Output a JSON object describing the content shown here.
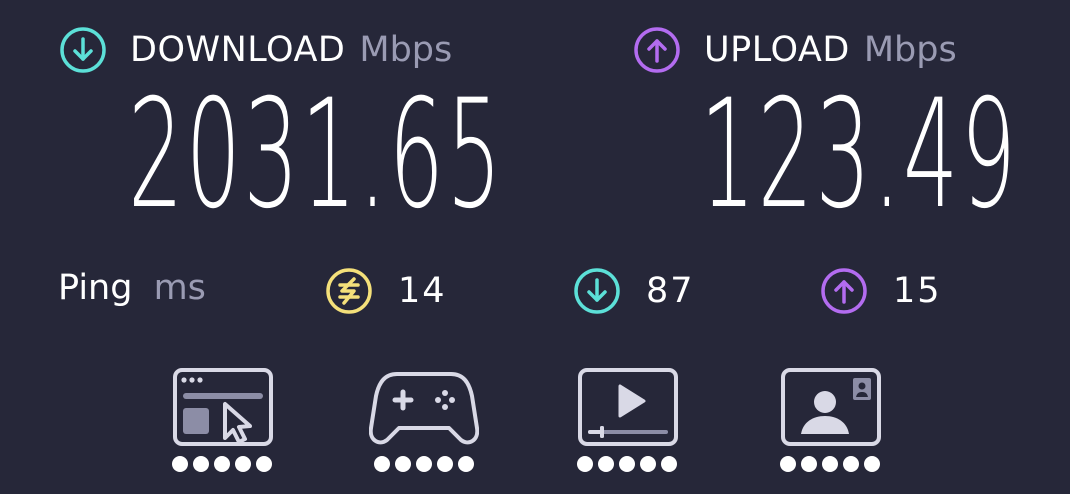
{
  "download": {
    "label": "DOWNLOAD",
    "unit": "Mbps",
    "value": "2031.65",
    "icon": "arrow-down-circle-icon",
    "color": "#5ce0d8"
  },
  "upload": {
    "label": "UPLOAD",
    "unit": "Mbps",
    "value": "123.49",
    "icon": "arrow-up-circle-icon",
    "color": "#b36cf0"
  },
  "ping": {
    "label": "Ping",
    "unit": "ms",
    "idle": {
      "value": "14",
      "icon": "ping-idle-icon",
      "color": "#f4e07a"
    },
    "download": {
      "value": "87",
      "icon": "arrow-down-circle-icon",
      "color": "#5ce0d8"
    },
    "upload": {
      "value": "15",
      "icon": "arrow-up-circle-icon",
      "color": "#b36cf0"
    }
  },
  "usage": [
    {
      "icon": "web-browsing-icon",
      "rating": 5,
      "max": 5
    },
    {
      "icon": "gaming-icon",
      "rating": 5,
      "max": 5
    },
    {
      "icon": "video-streaming-icon",
      "rating": 5,
      "max": 5
    },
    {
      "icon": "video-chat-icon",
      "rating": 5,
      "max": 5
    }
  ],
  "colors": {
    "background": "#262739",
    "text": "#ffffff",
    "unit": "#9a9bb3",
    "icon_stroke": "#d9d9e6"
  }
}
